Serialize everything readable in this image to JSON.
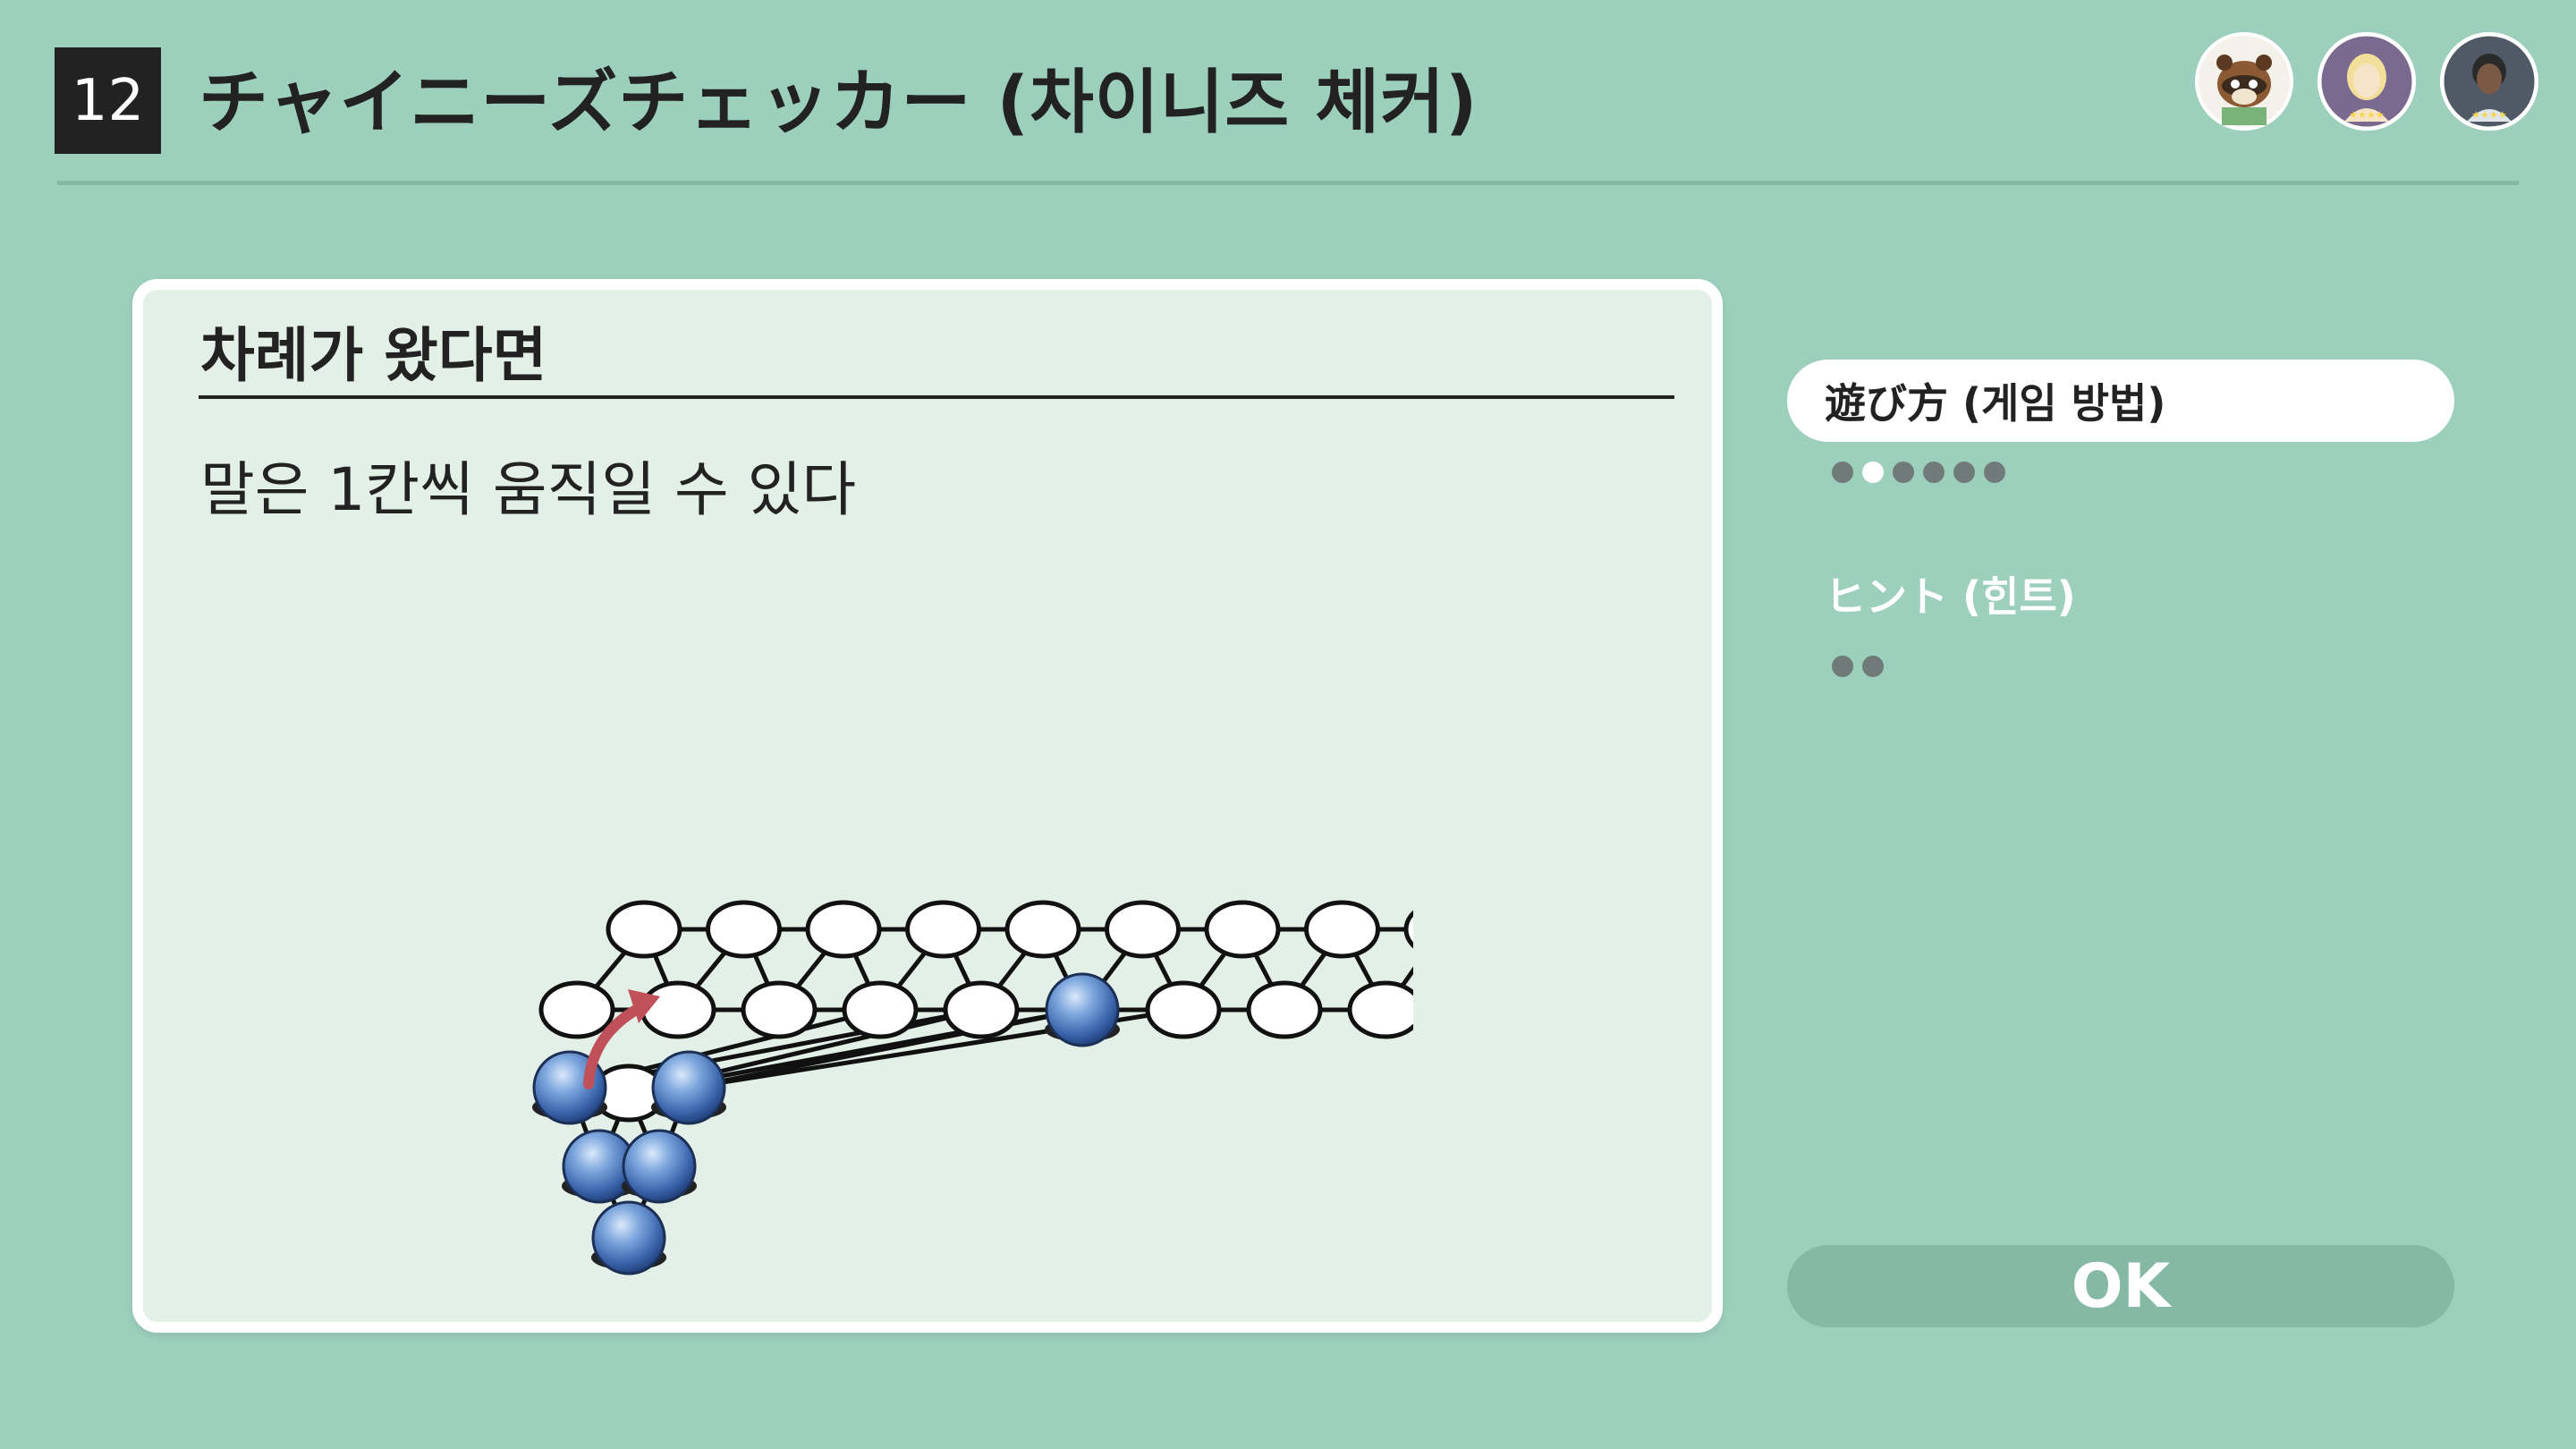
{
  "header": {
    "rule_number": "12",
    "title": "チャイニーズチェッカー (차이니즈 체커)"
  },
  "players": [
    {
      "name": "raccoon-character"
    },
    {
      "name": "blonde-character"
    },
    {
      "name": "dark-hair-character"
    }
  ],
  "card": {
    "heading": "차례가 왔다면",
    "body": "말은 1칸씩 움직일 수 있다"
  },
  "menu": {
    "items": [
      {
        "label": "遊び方 (게임 방법)",
        "pages": 6,
        "current_page": 2,
        "active": true
      },
      {
        "label": "ヒント (힌트)",
        "pages": 2,
        "current_page": 0,
        "active": false
      }
    ]
  },
  "ok_button": {
    "label": "OK"
  },
  "colors": {
    "background": "#9dcfbd",
    "card": "#e3f0e7",
    "piece": "#4a7cc4",
    "arrow": "#c0505a"
  }
}
